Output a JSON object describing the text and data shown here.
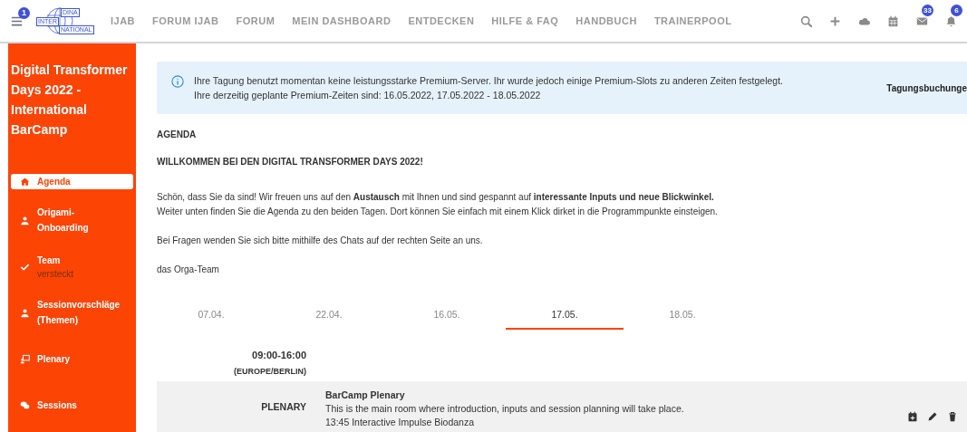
{
  "topbar": {
    "menu_badge": "1",
    "logo": {
      "top": "DINA",
      "left": "INTER",
      "bottom": "NATIONAL"
    },
    "nav": [
      "IJAB",
      "FORUM IJAB",
      "FORUM",
      "MEIN DASHBOARD",
      "ENTDECKEN",
      "HILFE & FAQ",
      "HANDBUCH",
      "TRAINERPOOL"
    ],
    "icons": [
      {
        "kind": "search"
      },
      {
        "kind": "plus"
      },
      {
        "kind": "cloud"
      },
      {
        "kind": "calendar"
      },
      {
        "kind": "mail",
        "badge": "33"
      },
      {
        "kind": "bell",
        "badge": "6"
      }
    ]
  },
  "sidebar": {
    "title": "Digital Transformer Days 2022 - International BarCamp",
    "items": [
      {
        "kind": "home",
        "label": "Agenda",
        "selected": true
      },
      {
        "kind": "user",
        "label": "Origami-Onboarding",
        "selected": false
      },
      {
        "kind": "check",
        "label": "Team",
        "sublabel": "versteckt",
        "selected": false
      },
      {
        "kind": "user",
        "label": "Sessionvorschläge (Themen)",
        "selected": false
      },
      {
        "kind": "screen",
        "label": "Plenary",
        "selected": false
      },
      {
        "kind": "chat",
        "label": "Sessions",
        "selected": false
      }
    ]
  },
  "notice": {
    "lines": [
      "Ihre Tagung benutzt momentan keine leistungsstarke Premium-Server. Ihr wurde jedoch einige Premium-Slots zu anderen Zeiten festgelegt.",
      "Ihre derzeitig geplante Premium-Zeiten sind: 16.05.2022, 17.05.2022 - 18.05.2022"
    ],
    "link": "Tagungsbuchunge"
  },
  "heading": "AGENDA",
  "welcome": "WILLKOMMEN BEI DEN DIGITAL TRANSFORMER DAYS 2022!",
  "paragraphs": [
    "Schön, dass Sie da sind! Wir freuen uns auf den **Austausch** mit Ihnen und sind gespannt auf **interessante Inputs und neue Blickwinkel.**",
    "Weiter unten finden Sie die Agenda zu den beiden Tagen. Dort können Sie einfach mit einem Klick dirket in die Programmpunkte einsteigen.",
    "Bei Fragen wenden Sie sich bitte mithilfe des Chats auf der rechten Seite an uns.",
    "das Orga-Team"
  ],
  "date_tabs": [
    {
      "label": "07.04.",
      "selected": false
    },
    {
      "label": "22.04.",
      "selected": false
    },
    {
      "label": "16.05.",
      "selected": false
    },
    {
      "label": "17.05.",
      "selected": true
    },
    {
      "label": "18.05.",
      "selected": false
    }
  ],
  "time": "09:00-16:00",
  "timezone": "(EUROPE/BERLIN)",
  "sessions": [
    {
      "room": "PLENARY",
      "title": "BarCamp Plenary",
      "lines": [
        "This is the main room where introduction, inputs and session planning will take place.",
        "13:45 Interactive Impulse Biodanza"
      ]
    }
  ]
}
